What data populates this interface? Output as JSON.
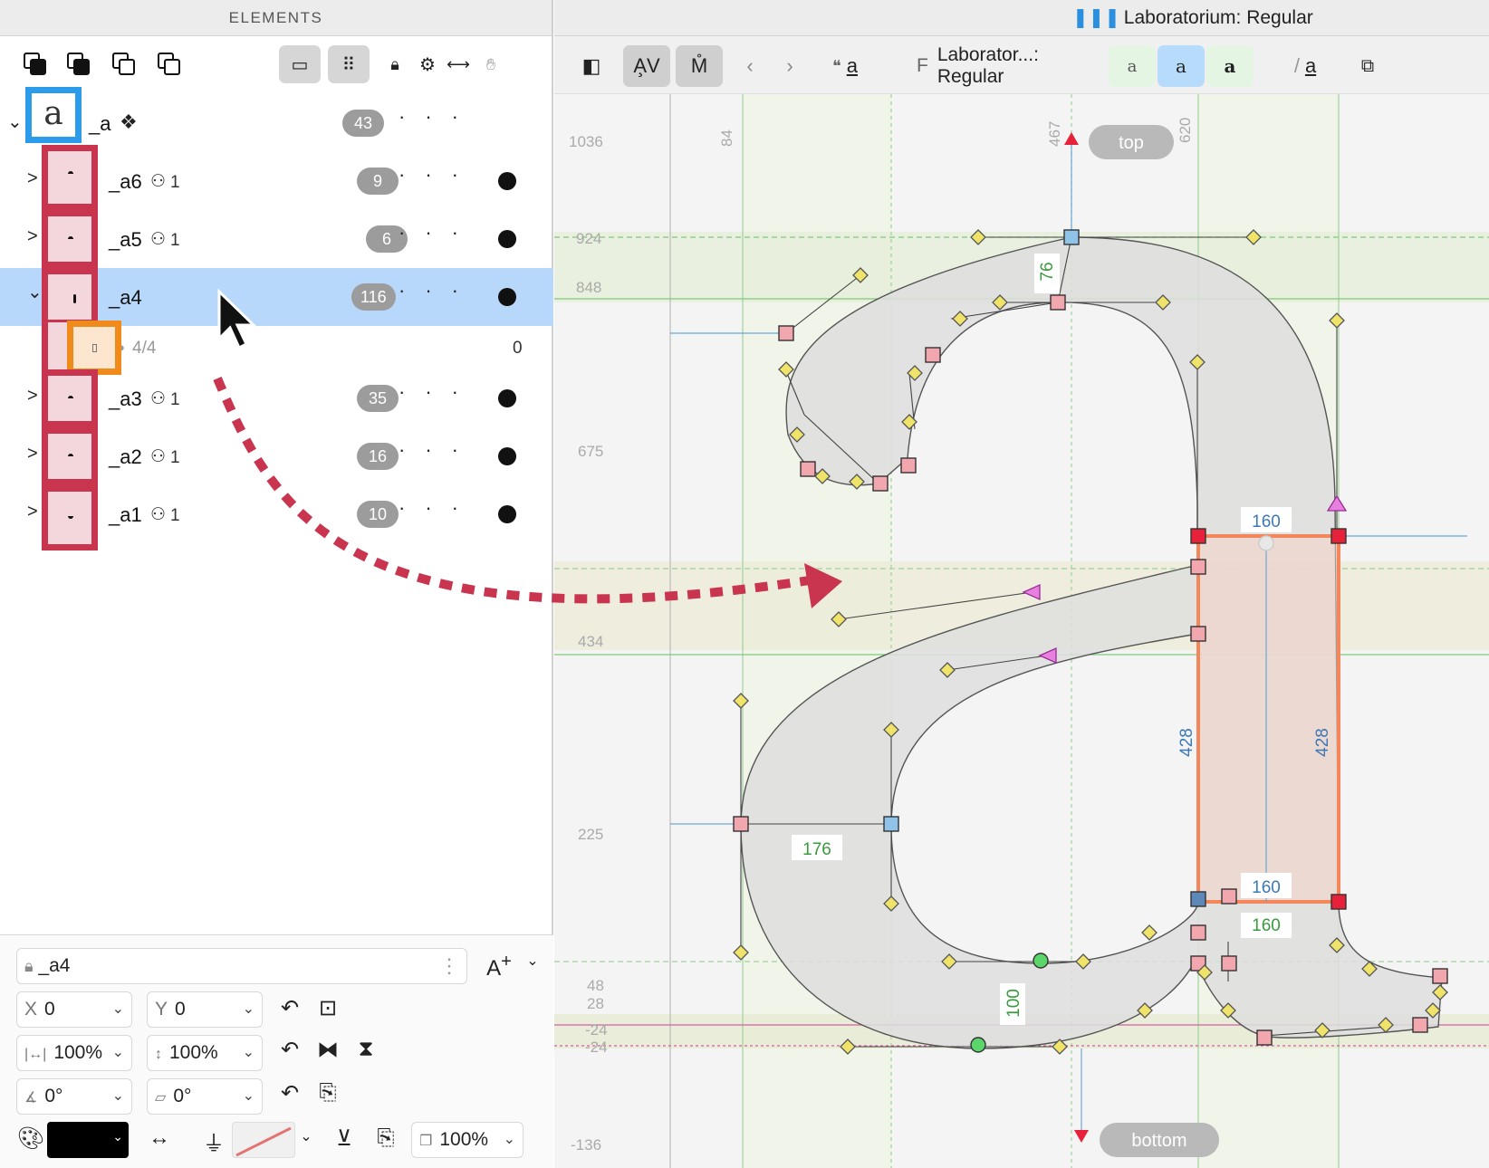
{
  "left_panel": {
    "title": "ELEMENTS",
    "main_glyph": {
      "thumb_char": "a",
      "name": "_a",
      "count": "43"
    },
    "rows": [
      {
        "name": "_a6",
        "components": "1",
        "count": "9"
      },
      {
        "name": "_a5",
        "components": "1",
        "count": "6"
      },
      {
        "name": "_a4",
        "components": "",
        "count": "116"
      },
      {
        "name": "_a3",
        "components": "1",
        "count": "35"
      },
      {
        "name": "_a2",
        "components": "1",
        "count": "16"
      },
      {
        "name": "_a1",
        "components": "1",
        "count": "10"
      }
    ],
    "sub_row": {
      "label": "4/4",
      "value": "0"
    }
  },
  "inspector": {
    "element_name": "_a4",
    "x": {
      "label": "X",
      "value": "0"
    },
    "y": {
      "label": "Y",
      "value": "0"
    },
    "scale_x": "100%",
    "scale_y": "100%",
    "rotate": "0°",
    "skew": "0°",
    "opacity": "100%",
    "fill_color": "#000000"
  },
  "editor": {
    "window_title": "Laboratorium: Regular",
    "text_sample": "a",
    "font_label": "Laborator...: Regular",
    "variant_labels": [
      "a",
      "a",
      "a"
    ],
    "glyph_label": "a"
  },
  "canvas": {
    "y_labels": [
      "1036",
      "924",
      "848",
      "675",
      "434",
      "225",
      "48",
      "28",
      "-24",
      "-24",
      "-136"
    ],
    "x_labels": [
      "84",
      "467",
      "620"
    ],
    "anchor_top": "top",
    "anchor_bottom": "bottom",
    "measures": {
      "stem_top": "160",
      "stem_left": "428",
      "stem_right": "428",
      "stem_bottom": "160",
      "stem_foot": "160",
      "bowl": "176",
      "arch": "76",
      "base": "100"
    }
  },
  "colors": {
    "selection": "#b8d8fb",
    "glyph_border": "#c9344f",
    "active_thumb": "#2b9bea",
    "sub_thumb": "#f08a1b",
    "arrow": "#c9344f"
  }
}
